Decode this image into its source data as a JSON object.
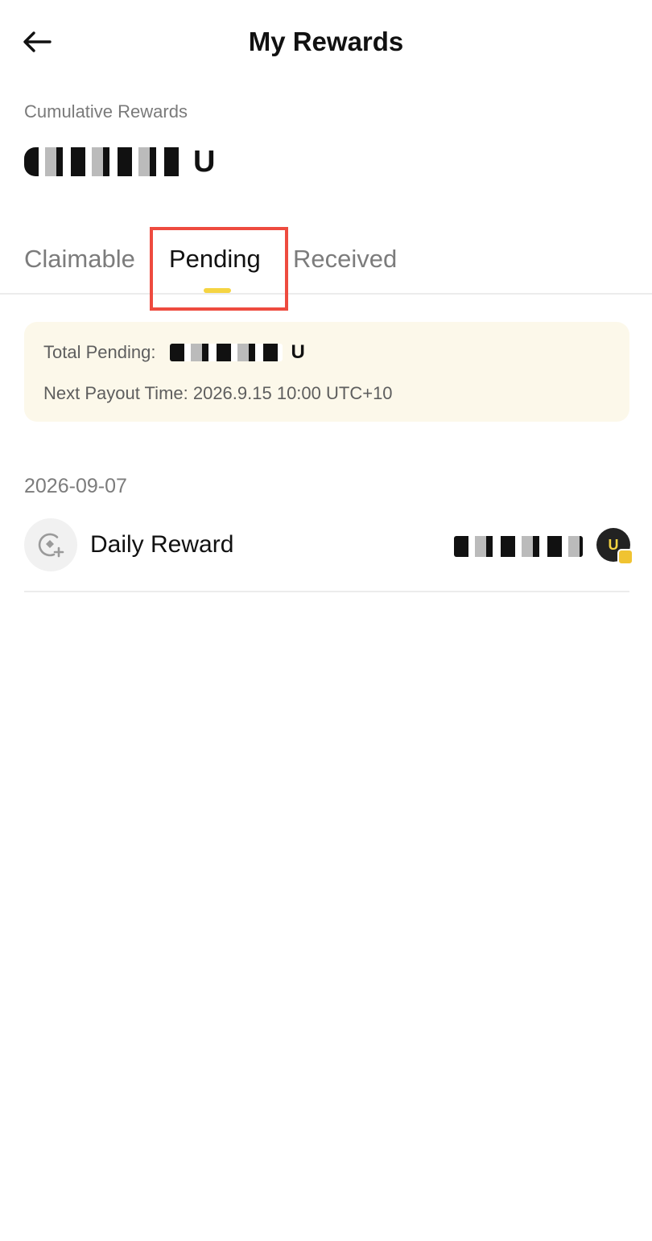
{
  "header": {
    "title": "My Rewards"
  },
  "summary": {
    "cumulative_label": "Cumulative Rewards",
    "cumulative_unit": "U"
  },
  "tabs": [
    {
      "label": "Claimable",
      "active": false
    },
    {
      "label": "Pending",
      "active": true
    },
    {
      "label": "Received",
      "active": false
    }
  ],
  "pending_card": {
    "total_label": "Total Pending:",
    "total_unit": "U",
    "next_payout": "Next Payout Time: 2026.9.15 10:00 UTC+10"
  },
  "groups": [
    {
      "date": "2026-09-07",
      "items": [
        {
          "title": "Daily Reward",
          "icon": "reward-add-icon",
          "token_icon": "u-token-icon",
          "token_symbol": "U"
        }
      ]
    }
  ],
  "colors": {
    "accent": "#f5d442",
    "highlight": "#ee4b3f",
    "card_bg": "#fcf8ea",
    "muted_text": "#7c7c7c"
  }
}
